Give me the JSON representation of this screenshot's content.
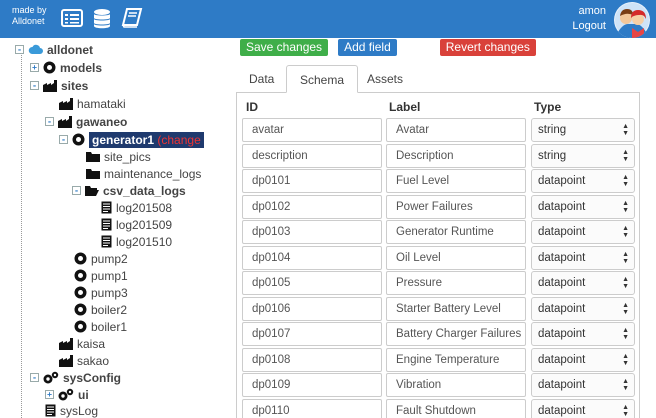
{
  "topbar": {
    "made_by_label": "made by",
    "made_by_name": "Alldonet",
    "username": "amon",
    "logout_label": "Logout",
    "color": "#2e7bc6",
    "icons": [
      "table-icon",
      "database-icon",
      "book-icon"
    ]
  },
  "tree": {
    "root": "alldonet",
    "nodes": {
      "models": "models",
      "sites": "sites",
      "hamataki": "hamataki",
      "gawaneo": "gawaneo",
      "generator1": "generator1",
      "generator1_flag": "(change",
      "site_pics": "site_pics",
      "maintenance_logs": "maintenance_logs",
      "csv_data_logs": "csv_data_logs",
      "log201508": "log201508",
      "log201509": "log201509",
      "log201510": "log201510",
      "pump2": "pump2",
      "pump1": "pump1",
      "pump3": "pump3",
      "boiler2": "boiler2",
      "boiler1": "boiler1",
      "kaisa": "kaisa",
      "sakao": "sakao",
      "sysConfig": "sysConfig",
      "ui": "ui",
      "sysLog": "sysLog"
    }
  },
  "actions": {
    "save": "Save changes",
    "save_color": "#3fae49",
    "add_field": "Add field",
    "add_field_color": "#2e7bc6",
    "revert": "Revert changes",
    "revert_color": "#d9413a"
  },
  "tabs": [
    {
      "label": "Data",
      "active": false
    },
    {
      "label": "Schema",
      "active": true
    },
    {
      "label": "Assets",
      "active": false
    }
  ],
  "schema": {
    "headers": {
      "id": "ID",
      "label": "Label",
      "type": "Type"
    },
    "rows": [
      {
        "id": "avatar",
        "label": "Avatar",
        "type": "string"
      },
      {
        "id": "description",
        "label": "Description",
        "type": "string"
      },
      {
        "id": "dp0101",
        "label": "Fuel Level",
        "type": "datapoint"
      },
      {
        "id": "dp0102",
        "label": "Power Failures",
        "type": "datapoint"
      },
      {
        "id": "dp0103",
        "label": "Generator Runtime",
        "type": "datapoint"
      },
      {
        "id": "dp0104",
        "label": "Oil Level",
        "type": "datapoint"
      },
      {
        "id": "dp0105",
        "label": "Pressure",
        "type": "datapoint"
      },
      {
        "id": "dp0106",
        "label": "Starter Battery Level",
        "type": "datapoint"
      },
      {
        "id": "dp0107",
        "label": "Battery Charger Failures",
        "type": "datapoint"
      },
      {
        "id": "dp0108",
        "label": "Engine Temperature",
        "type": "datapoint"
      },
      {
        "id": "dp0109",
        "label": "Vibration",
        "type": "datapoint"
      },
      {
        "id": "dp0110",
        "label": "Fault Shutdown",
        "type": "datapoint"
      }
    ]
  }
}
